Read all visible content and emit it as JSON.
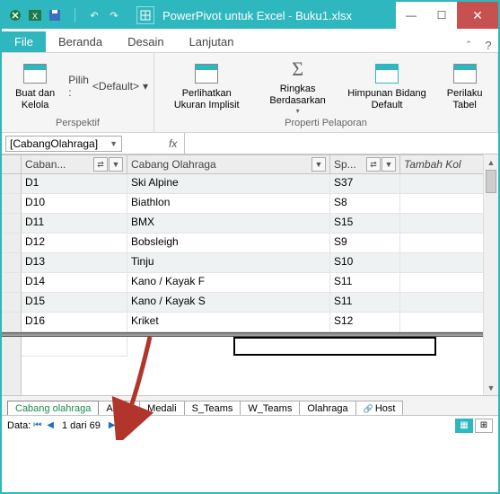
{
  "window": {
    "title": "PowerPivot untuk Excel - Buku1.xlsx"
  },
  "ribbon": {
    "tabs": {
      "file": "File",
      "home": "Beranda",
      "design": "Desain",
      "advanced": "Lanjutan"
    },
    "group_perspektif": {
      "label": "Perspektif",
      "create": "Buat dan\nKelola",
      "select_label": "Pilih :",
      "select_value": "<Default>"
    },
    "group_properti": {
      "label": "Properti Pelaporan",
      "implicit": "Perlihatkan\nUkuran Implisit",
      "ringkas": "Ringkas\nBerdasarkan",
      "default_fields": "Himpunan\nBidang Default",
      "behavior": "Perilaku\nTabel"
    }
  },
  "formula": {
    "namebox": "[CabangOlahraga]",
    "fx": "fx",
    "value": ""
  },
  "grid": {
    "headers": {
      "c1": "Caban...",
      "c2": "Cabang Olahraga",
      "c3": "Sp...",
      "c4": "Tambah Kol"
    },
    "rows": [
      {
        "c1": "D1",
        "c2": "Ski Alpine",
        "c3": "S37"
      },
      {
        "c1": "D10",
        "c2": "Biathlon",
        "c3": "S8"
      },
      {
        "c1": "D11",
        "c2": "BMX",
        "c3": "S15"
      },
      {
        "c1": "D12",
        "c2": "Bobsleigh",
        "c3": "S9"
      },
      {
        "c1": "D13",
        "c2": "Tinju",
        "c3": "S10"
      },
      {
        "c1": "D14",
        "c2": "Kano / Kayak F",
        "c3": "S11"
      },
      {
        "c1": "D15",
        "c2": "Kano / Kayak S",
        "c3": "S11"
      },
      {
        "c1": "D16",
        "c2": "Kriket",
        "c3": "S12"
      }
    ]
  },
  "sheets": {
    "items": [
      {
        "label": "Cabang olahraga",
        "active": true
      },
      {
        "label": "Acara"
      },
      {
        "label": "Medali"
      },
      {
        "label": "S_Teams"
      },
      {
        "label": "W_Teams"
      },
      {
        "label": "Olahraga"
      },
      {
        "label": "Host",
        "linked": true
      }
    ]
  },
  "status": {
    "data_label": "Data:",
    "record": "1 dari 69"
  }
}
